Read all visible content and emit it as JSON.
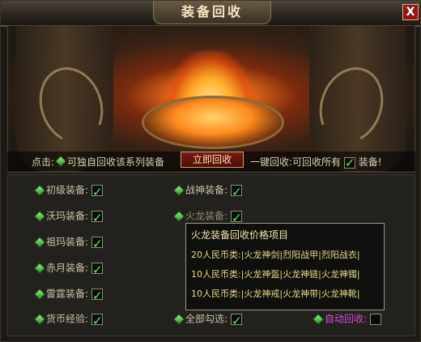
{
  "window": {
    "title": "装备回收",
    "close_label": "X"
  },
  "instructions": {
    "left_prefix": "点击:",
    "left_suffix": "可独自回收该系列装备",
    "recycle_button": "立即回收",
    "right_prefix": "一键回收:可回收所有",
    "right_suffix": "装备!"
  },
  "left_column": [
    {
      "label": "初级装备:",
      "checked": true
    },
    {
      "label": "沃玛装备:",
      "checked": true
    },
    {
      "label": "祖玛装备:",
      "checked": true
    },
    {
      "label": "赤月装备:",
      "checked": true
    },
    {
      "label": "雷霆装备:",
      "checked": true
    },
    {
      "label": "货币经验:",
      "checked": true
    }
  ],
  "right_column": [
    {
      "label": "战神装备:",
      "checked": true
    },
    {
      "label": "火龙装备:",
      "checked": true
    }
  ],
  "select_all": {
    "label": "全部勾选:",
    "checked": true
  },
  "auto_recycle": {
    "label": "自动回收:",
    "checked": false
  },
  "tooltip": {
    "title": "火龙装备回收价格项目",
    "lines": [
      "20人民币类:|火龙神剑|烈阳战甲|烈阳战衣|",
      "10人民币类:|火龙神盔|火龙神链|火龙神镯|",
      "10人民币类:|火龙神戒|火龙神带|火龙神靴|"
    ]
  }
}
